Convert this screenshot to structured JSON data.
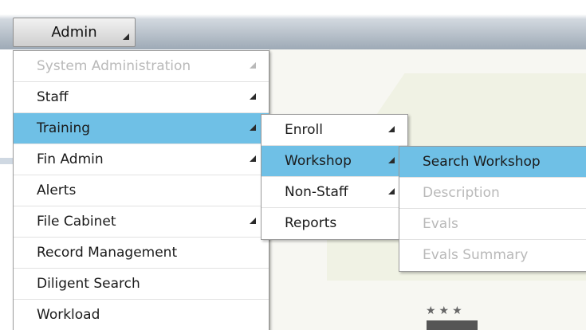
{
  "toolbar": {
    "admin_label": "Admin"
  },
  "admin_menu": {
    "items": [
      {
        "label": "System Administration",
        "disabled": true
      },
      {
        "label": "Staff"
      },
      {
        "label": "Training",
        "active": true
      },
      {
        "label": "Fin Admin"
      },
      {
        "label": "Alerts"
      },
      {
        "label": "File Cabinet"
      },
      {
        "label": "Record Management"
      },
      {
        "label": "Diligent Search"
      },
      {
        "label": "Workload"
      }
    ]
  },
  "training_menu": {
    "items": [
      {
        "label": "Enroll"
      },
      {
        "label": "Workshop",
        "active": true
      },
      {
        "label": "Non-Staff"
      },
      {
        "label": "Reports"
      }
    ]
  },
  "workshop_menu": {
    "items": [
      {
        "label": "Search Workshop",
        "active": true
      },
      {
        "label": "Description",
        "disabled": true
      },
      {
        "label": "Evals",
        "disabled": true
      },
      {
        "label": "Evals Summary",
        "disabled": true
      }
    ]
  },
  "background": {
    "stars": "★★★"
  },
  "colors": {
    "highlight": "#6fc0e6",
    "disabled_text": "#b9b9b9",
    "toolbar_bottom": "#9eaab6"
  }
}
